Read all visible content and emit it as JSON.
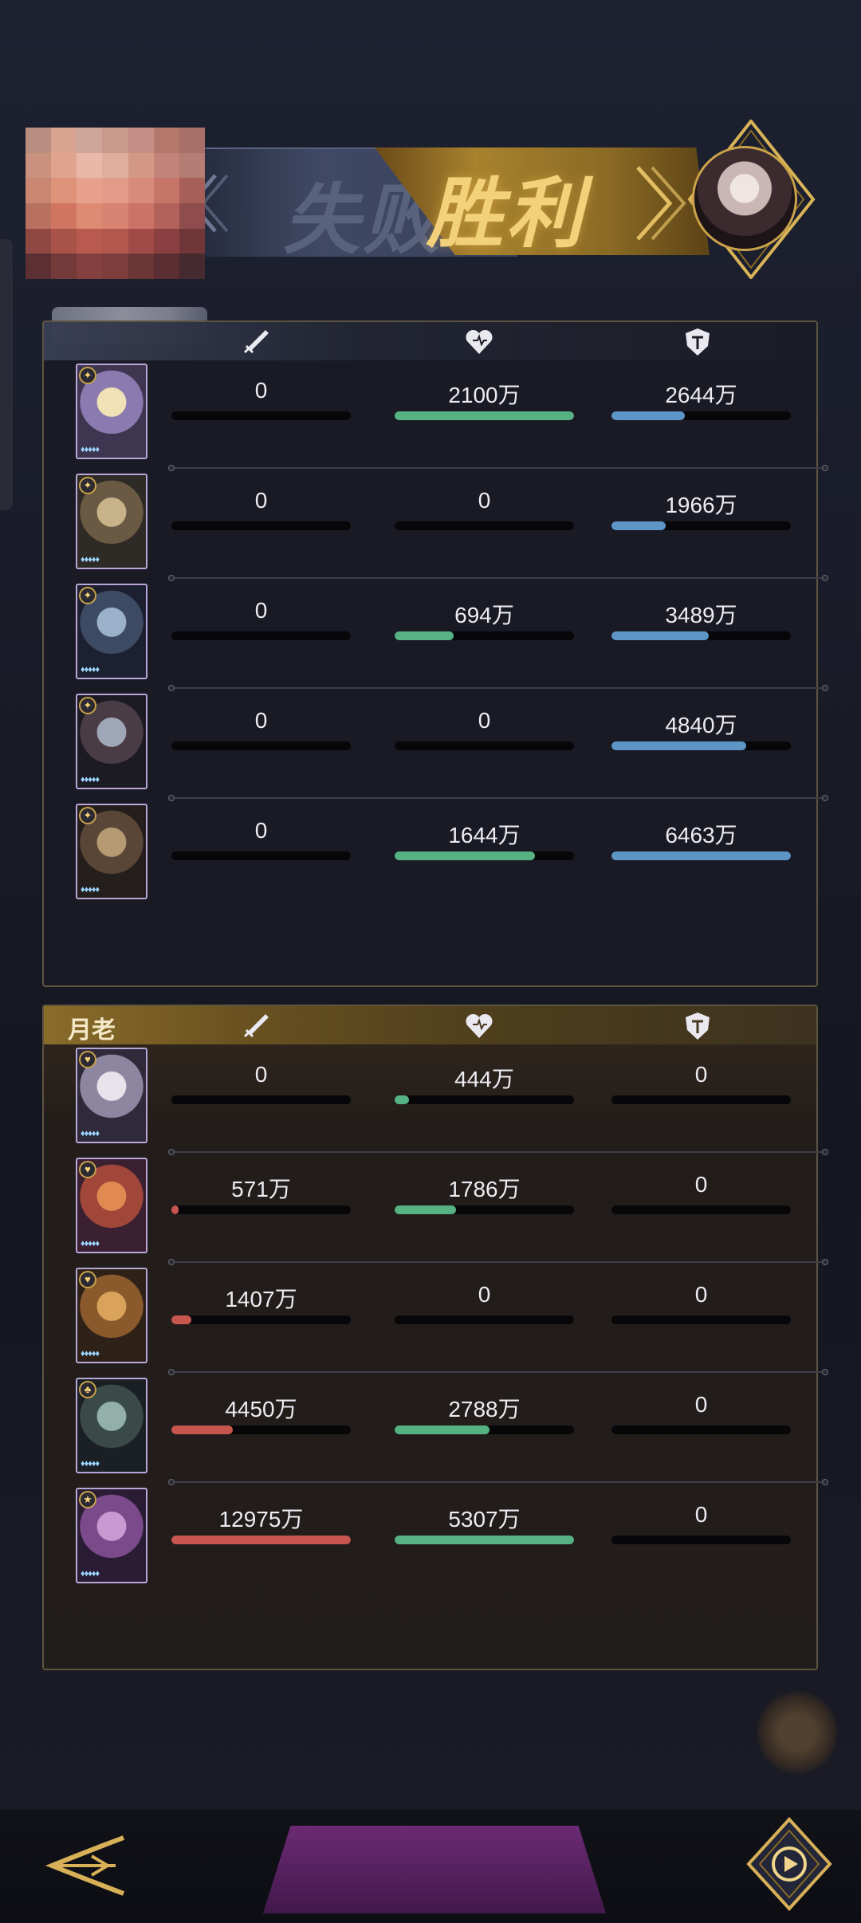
{
  "header": {
    "lose_label": "失败",
    "win_label": "胜利"
  },
  "colors": {
    "attack_bar": "#c8564e",
    "heal_bar": "#57b283",
    "defense_bar": "#5c95c6",
    "panel_border": "#5e5540",
    "gold": "#c9a24a"
  },
  "columns": {
    "attack_icon": "sword-icon",
    "heal_icon": "heart-icon",
    "defense_icon": "shield-icon"
  },
  "team_left": {
    "name": "",
    "rows": [
      {
        "attack": "0",
        "heal": "2100万",
        "defense": "2644万",
        "attack_frac": 0,
        "heal_frac": 1.0,
        "defense_frac": 0.41
      },
      {
        "attack": "0",
        "heal": "0",
        "defense": "1966万",
        "attack_frac": 0,
        "heal_frac": 0,
        "defense_frac": 0.3
      },
      {
        "attack": "0",
        "heal": "694万",
        "defense": "3489万",
        "attack_frac": 0,
        "heal_frac": 0.33,
        "defense_frac": 0.54
      },
      {
        "attack": "0",
        "heal": "0",
        "defense": "4840万",
        "attack_frac": 0,
        "heal_frac": 0,
        "defense_frac": 0.75
      },
      {
        "attack": "0",
        "heal": "1644万",
        "defense": "6463万",
        "attack_frac": 0,
        "heal_frac": 0.78,
        "defense_frac": 1.0
      }
    ]
  },
  "team_right": {
    "name": "月老",
    "rows": [
      {
        "attack": "0",
        "heal": "444万",
        "defense": "0",
        "attack_frac": 0,
        "heal_frac": 0.08,
        "defense_frac": 0
      },
      {
        "attack": "571万",
        "heal": "1786万",
        "defense": "0",
        "attack_frac": 0.04,
        "heal_frac": 0.34,
        "defense_frac": 0
      },
      {
        "attack": "1407万",
        "heal": "0",
        "defense": "0",
        "attack_frac": 0.11,
        "heal_frac": 0,
        "defense_frac": 0
      },
      {
        "attack": "4450万",
        "heal": "2788万",
        "defense": "0",
        "attack_frac": 0.34,
        "heal_frac": 0.53,
        "defense_frac": 0
      },
      {
        "attack": "12975万",
        "heal": "5307万",
        "defense": "0",
        "attack_frac": 1.0,
        "heal_frac": 1.0,
        "defense_frac": 0
      }
    ]
  },
  "footer": {
    "back_icon": "back-arrow-icon",
    "replay_icon": "replay-icon"
  }
}
